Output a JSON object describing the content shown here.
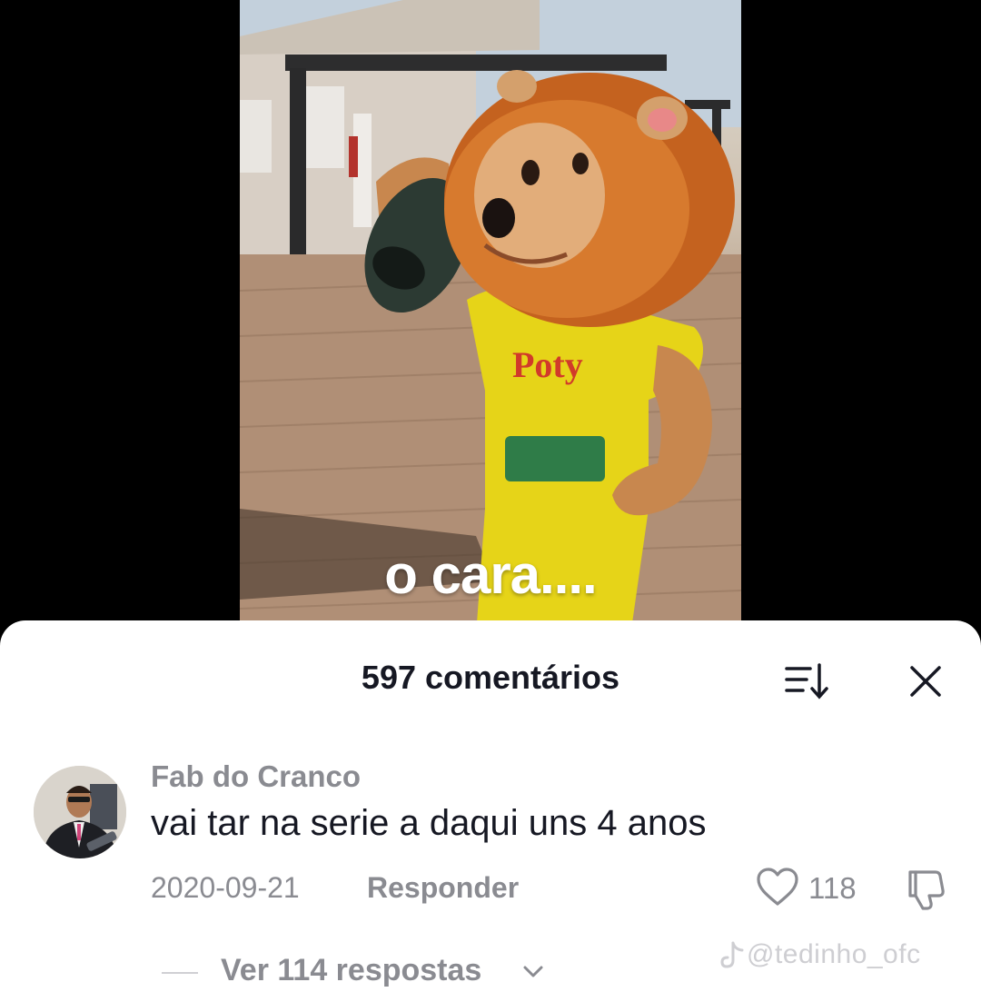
{
  "video": {
    "caption": "o cara...."
  },
  "sheet": {
    "title": "597 comentários",
    "sort_icon": "sort-icon",
    "close_icon": "close-icon"
  },
  "comment": {
    "author": "Fab do Cranco",
    "text": "vai tar na serie a daqui uns 4 anos",
    "date": "2020-09-21",
    "reply_label": "Responder",
    "like_count": "118",
    "view_replies_label": "Ver 114 respostas"
  },
  "watermark": {
    "text": "@tedinho_ofc",
    "icon": "tiktok-icon"
  },
  "colors": {
    "text_primary": "#161823",
    "text_secondary": "#8a8b91",
    "sheet_background": "#ffffff",
    "page_background": "#000000"
  }
}
